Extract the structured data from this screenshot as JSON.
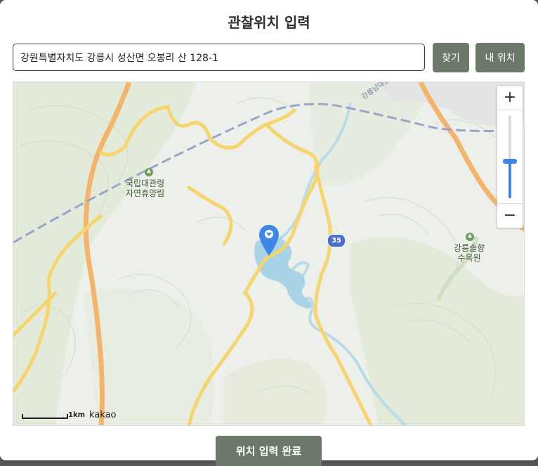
{
  "modal": {
    "title": "관찰위치 입력"
  },
  "search": {
    "value": "강원특별자치도 강릉시 성산면 오봉리 산 128-1",
    "find_label": "찾기",
    "my_location_label": "내 위치"
  },
  "map": {
    "zoom_in": "+",
    "zoom_out": "−",
    "zoom_level_fraction": 0.45,
    "labels": {
      "forest": "국립대관령\n자연휴양림",
      "arboretum": "강릉솔향\n수목원",
      "road_badge": "35",
      "road_name": "강릉남대천"
    },
    "scale": "1km",
    "attribution": "kakao",
    "icons": [
      "zoom-in-icon",
      "zoom-out-icon",
      "location-pin-icon",
      "park-icon",
      "road-route-badge"
    ]
  },
  "footer": {
    "done_label": "위치 입력 완료"
  },
  "colors": {
    "button": "#6b786a",
    "accent": "#3e86e8",
    "water": "#a9d3e6",
    "road_yellow": "#f7d56e",
    "road_orange": "#f4b46b",
    "rail": "#9aa6c8"
  }
}
